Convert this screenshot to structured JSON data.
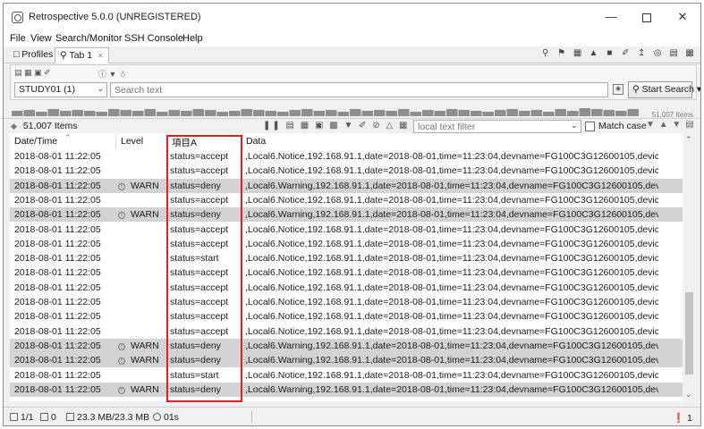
{
  "window": {
    "title": "Retrospective 5.0.0 (UNREGISTERED)"
  },
  "menu": [
    "File",
    "View",
    "Search/Monitor",
    "SSH Console",
    "Help"
  ],
  "tabs": {
    "profiles": "Profiles",
    "active": "Tab 1"
  },
  "search": {
    "study": "STUDY01 (1)",
    "placeholder": "Search text",
    "button": "Start Search"
  },
  "histogram": {
    "label": "51,007 Items"
  },
  "results": {
    "count": "51,007 Items",
    "filter_placeholder": "local text filter",
    "match_case": "Match case"
  },
  "columns": {
    "date": "Date/Time",
    "level": "Level",
    "item": "項目A",
    "data": "Data"
  },
  "rows": [
    {
      "date": "2018-08-01 11:22:05",
      "level": "",
      "item": "status=accept",
      "data": ",Local6.Notice,192.168.91.1,date=2018-08-01,time=11:23:04,devname=FG100C3G12600105,device_i..."
    },
    {
      "date": "2018-08-01 11:22:05",
      "level": "",
      "item": "status=accept",
      "data": ",Local6.Notice,192.168.91.1,date=2018-08-01,time=11:23:04,devname=FG100C3G12600105,device_i..."
    },
    {
      "date": "2018-08-01 11:22:05",
      "level": "WARN",
      "item": "status=deny",
      "data": ",Local6.Warning,192.168.91.1,date=2018-08-01,time=11:23:04,devname=FG100C3G12600105,devic..."
    },
    {
      "date": "2018-08-01 11:22:05",
      "level": "",
      "item": "status=accept",
      "data": ",Local6.Notice,192.168.91.1,date=2018-08-01,time=11:23:04,devname=FG100C3G12600105,device_i..."
    },
    {
      "date": "2018-08-01 11:22:05",
      "level": "WARN",
      "item": "status=deny",
      "data": ",Local6.Warning,192.168.91.1,date=2018-08-01,time=11:23:04,devname=FG100C3G12600105,devic..."
    },
    {
      "date": "2018-08-01 11:22:05",
      "level": "",
      "item": "status=accept",
      "data": ",Local6.Notice,192.168.91.1,date=2018-08-01,time=11:23:04,devname=FG100C3G12600105,device_i..."
    },
    {
      "date": "2018-08-01 11:22:05",
      "level": "",
      "item": "status=accept",
      "data": ",Local6.Notice,192.168.91.1,date=2018-08-01,time=11:23:04,devname=FG100C3G12600105,device_i..."
    },
    {
      "date": "2018-08-01 11:22:05",
      "level": "",
      "item": "status=start",
      "data": ",Local6.Notice,192.168.91.1,date=2018-08-01,time=11:23:04,devname=FG100C3G12600105,device_i..."
    },
    {
      "date": "2018-08-01 11:22:05",
      "level": "",
      "item": "status=accept",
      "data": ",Local6.Notice,192.168.91.1,date=2018-08-01,time=11:23:04,devname=FG100C3G12600105,device_i..."
    },
    {
      "date": "2018-08-01 11:22:05",
      "level": "",
      "item": "status=accept",
      "data": ",Local6.Notice,192.168.91.1,date=2018-08-01,time=11:23:04,devname=FG100C3G12600105,device_i..."
    },
    {
      "date": "2018-08-01 11:22:05",
      "level": "",
      "item": "status=accept",
      "data": ",Local6.Notice,192.168.91.1,date=2018-08-01,time=11:23:04,devname=FG100C3G12600105,device_i..."
    },
    {
      "date": "2018-08-01 11:22:05",
      "level": "",
      "item": "status=accept",
      "data": ",Local6.Notice,192.168.91.1,date=2018-08-01,time=11:23:04,devname=FG100C3G12600105,device_i..."
    },
    {
      "date": "2018-08-01 11:22:05",
      "level": "",
      "item": "status=accept",
      "data": ",Local6.Notice,192.168.91.1,date=2018-08-01,time=11:23:04,devname=FG100C3G12600105,device_i..."
    },
    {
      "date": "2018-08-01 11:22:05",
      "level": "WARN",
      "item": "status=deny",
      "data": ",Local6.Warning,192.168.91.1,date=2018-08-01,time=11:23:04,devname=FG100C3G12600105,devic..."
    },
    {
      "date": "2018-08-01 11:22:05",
      "level": "WARN",
      "item": "status=deny",
      "data": ",Local6.Warning,192.168.91.1,date=2018-08-01,time=11:23:04,devname=FG100C3G12600105,devic..."
    },
    {
      "date": "2018-08-01 11:22:05",
      "level": "",
      "item": "status=start",
      "data": ",Local6.Notice,192.168.91.1,date=2018-08-01,time=11:23:04,devname=FG100C3G12600105,device_i..."
    },
    {
      "date": "2018-08-01 11:22:05",
      "level": "WARN",
      "item": "status=deny",
      "data": ",Local6.Warning,192.168.91.1,date=2018-08-01,time=11:23:04,devname=FG100C3G12600105,devic..."
    }
  ],
  "status": {
    "pages": "1/1",
    "selected": "0",
    "memory": "23.3 MB/23.3 MB",
    "elapsed": "01s",
    "notifications": "1"
  },
  "colors": {
    "warn_row": "#d3d3d3",
    "highlight_box": "#e02020"
  }
}
